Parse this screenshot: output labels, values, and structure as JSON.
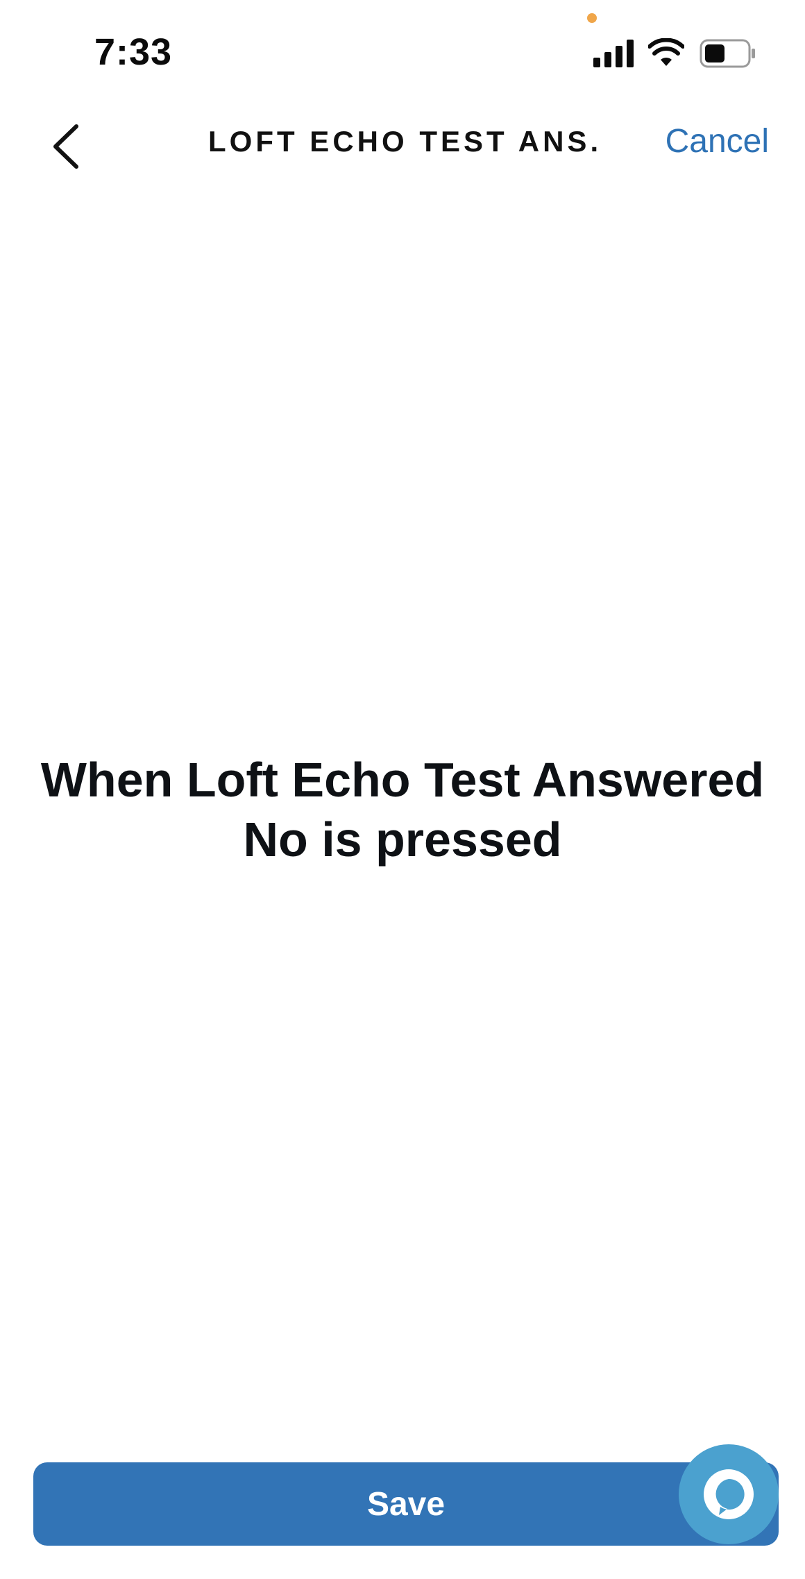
{
  "status_bar": {
    "time": "7:33",
    "icons": [
      "signal-icon",
      "wifi-icon",
      "battery-icon"
    ],
    "privacy_dot_color": "#f0a64a"
  },
  "nav": {
    "back_icon": "chevron-left-icon",
    "title": "LOFT ECHO TEST ANS...",
    "cancel_label": "Cancel"
  },
  "main": {
    "message_line1": "When Loft Echo Test Answered",
    "message_line2": "No is pressed"
  },
  "footer": {
    "save_label": "Save",
    "alexa_icon": "alexa-icon"
  },
  "colors": {
    "accent": "#3274b6",
    "link": "#2e72b5",
    "alexa": "#4ba1cf",
    "background": "#ffffff"
  }
}
